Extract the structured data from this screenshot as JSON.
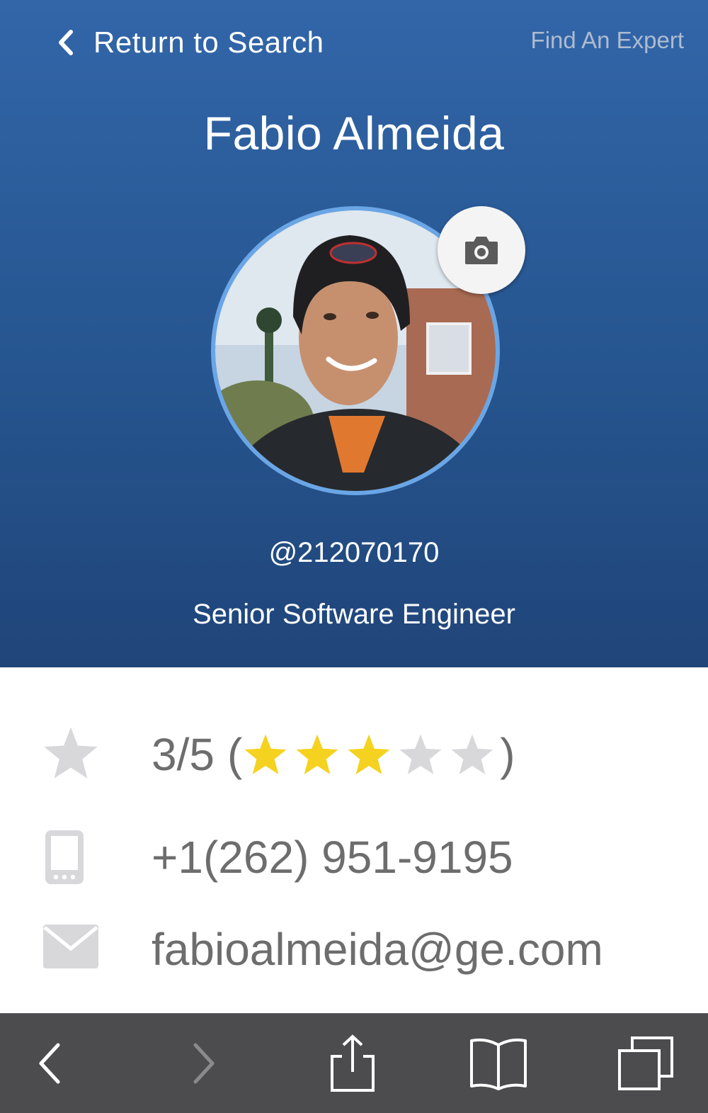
{
  "header": {
    "back_label": "Return to Search",
    "right_link": "Find An Expert"
  },
  "profile": {
    "name": "Fabio Almeida",
    "handle": "@212070170",
    "job_title": "Senior Software Engineer"
  },
  "rating": {
    "text": "3/5",
    "open_paren": "(",
    "close_paren": ")",
    "value": 3,
    "max": 5,
    "filled_color": "#f5d21f",
    "empty_color": "#d8d8db"
  },
  "contact": {
    "phone": "+1(262) 951-9195",
    "email": "fabioalmeida@ge.com"
  },
  "colors": {
    "header_top": "#3266a9",
    "header_bottom": "#20457a",
    "avatar_ring": "#6aa6e6",
    "icon_gray": "#d8d8db",
    "toolbar_bg": "#4c4c4e"
  },
  "icons": {
    "rating": "star-icon",
    "phone": "mobile-phone-icon",
    "email": "envelope-icon",
    "camera": "camera-icon",
    "toolbar": [
      "chevron-left-icon",
      "chevron-right-icon",
      "share-icon",
      "bookmarks-book-icon",
      "tabs-icon"
    ]
  }
}
